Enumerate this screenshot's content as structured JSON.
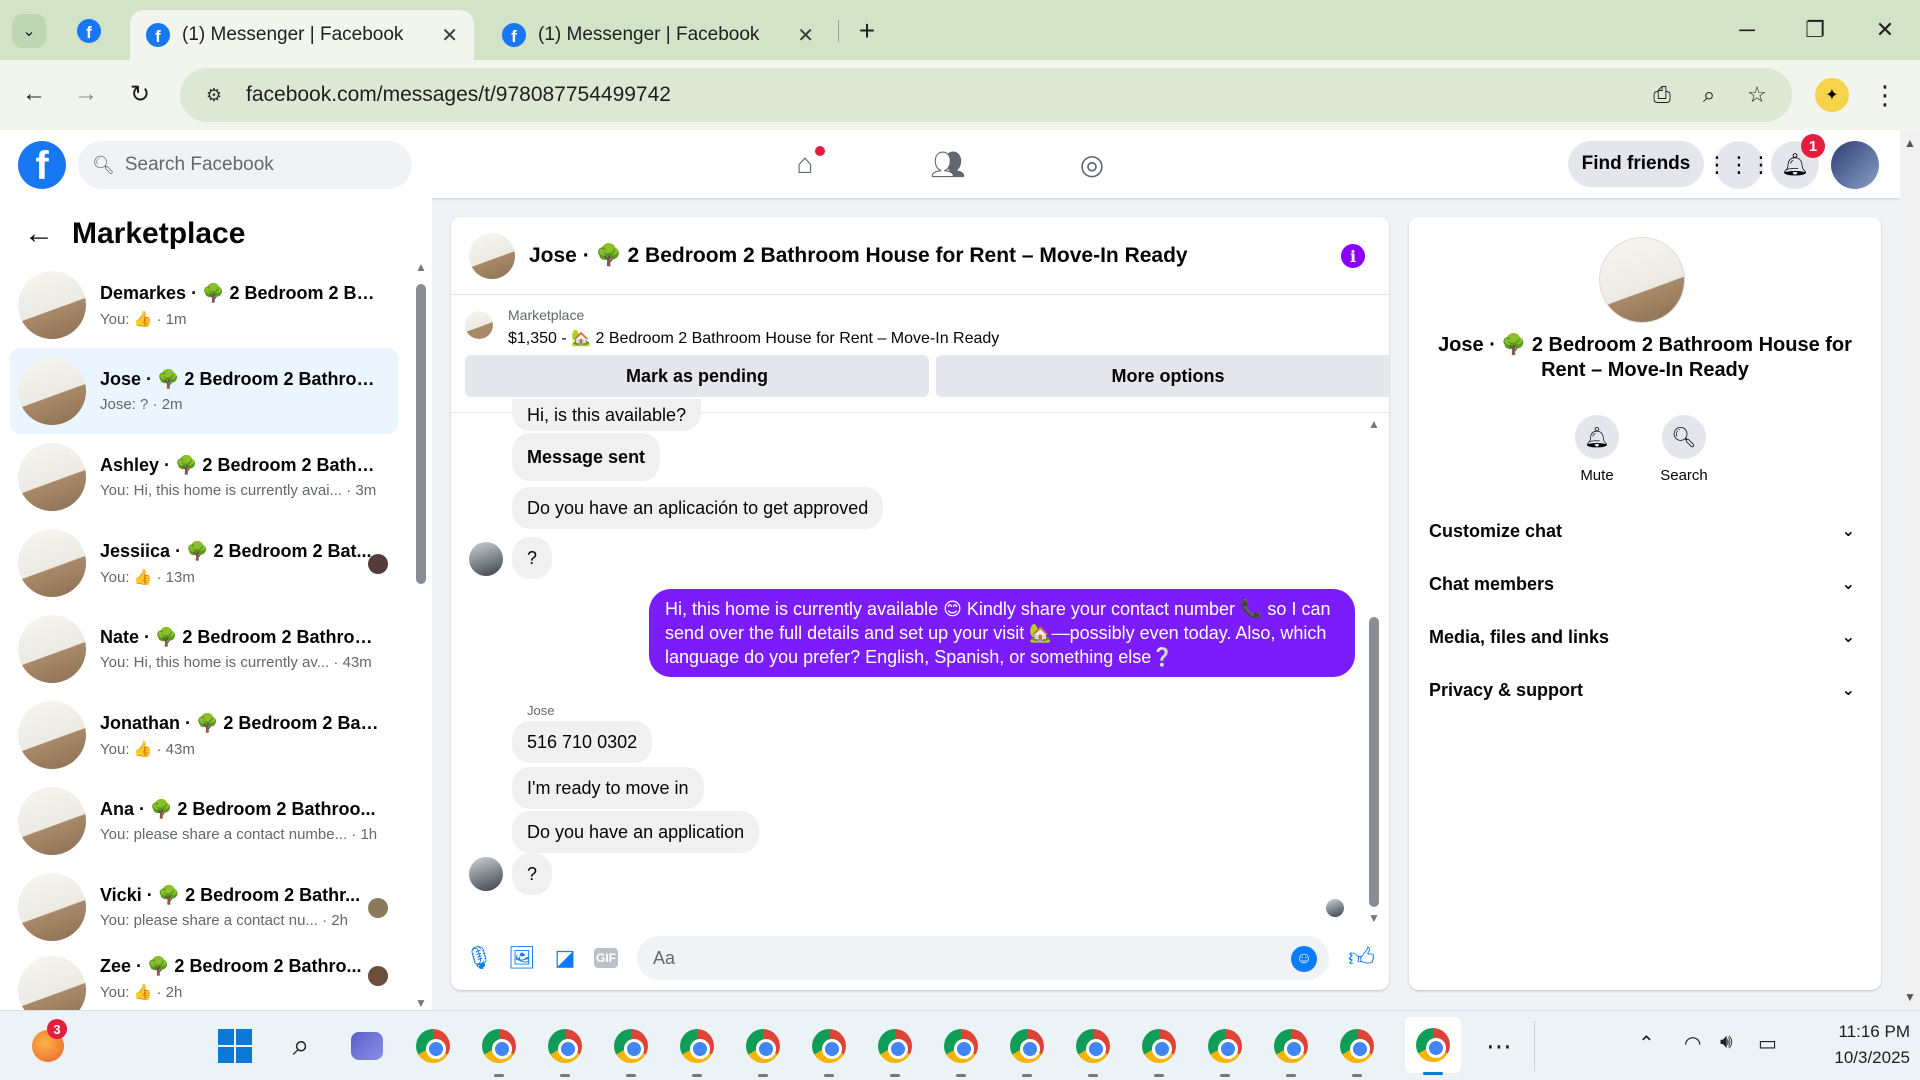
{
  "browser": {
    "tabs": [
      {
        "title": "(1) Messenger | Facebook"
      },
      {
        "title": "(1) Messenger | Facebook"
      }
    ],
    "url": "facebook.com/messages/t/978087754499742"
  },
  "fb": {
    "search_placeholder": "Search Facebook",
    "find_friends": "Find friends",
    "notification_count": "1"
  },
  "left": {
    "title": "Marketplace",
    "conversations": [
      {
        "name": "Demarkes · 🌳 2 Bedroom 2 Bat...",
        "preview": "You: 👍 · 1m"
      },
      {
        "name": "Jose · 🌳 2 Bedroom 2 Bathroo...",
        "preview": "Jose: ? · 2m"
      },
      {
        "name": "Ashley · 🌳 2 Bedroom 2 Bathro...",
        "preview": "You: Hi, this home is currently avai... · 3m"
      },
      {
        "name": "Jessiica · 🌳 2 Bedroom 2 Bat...",
        "preview": "You: 👍 · 13m"
      },
      {
        "name": "Nate · 🌳 2 Bedroom 2 Bathroo...",
        "preview": "You: Hi, this home is currently av... · 43m"
      },
      {
        "name": "Jonathan · 🌳 2 Bedroom 2 Bat...",
        "preview": "You: 👍 · 43m"
      },
      {
        "name": "Ana · 🌳 2 Bedroom 2 Bathroo...",
        "preview": "You: please share a contact numbe... · 1h"
      },
      {
        "name": "Vicki · 🌳 2 Bedroom 2 Bathr...",
        "preview": "You: please share a contact nu... · 2h"
      },
      {
        "name": "Zee · 🌳 2 Bedroom 2 Bathro...",
        "preview": "You: 👍 · 2h"
      }
    ]
  },
  "chat": {
    "title": "Jose · 🌳 2 Bedroom 2 Bathroom House for Rent – Move-In Ready",
    "listing_label": "Marketplace",
    "listing_price": "$1,350 - 🏡 2 Bedroom 2 Bathroom House for Rent – Move-In Ready",
    "mark_pending": "Mark as pending",
    "more_options": "More options",
    "messages": [
      {
        "text": "Hi, is this available?"
      },
      {
        "text": "Message sent"
      },
      {
        "text": "Do you have an aplicación to get approved"
      },
      {
        "text": "?"
      },
      {
        "text": "Hi, this home is currently available 😊 Kindly share your contact number 📞 so I can send over the full details and set up your visit 🏡—possibly even today. Also, which language do you prefer? English, Spanish, or something else❔"
      },
      {
        "text": "Jose"
      },
      {
        "text": "516 710 0302"
      },
      {
        "text": "I'm ready to move in"
      },
      {
        "text": "Do you have an application"
      },
      {
        "text": "?"
      }
    ],
    "composer_placeholder": "Aa",
    "gif_label": "GIF"
  },
  "info": {
    "title": "Jose · 🌳 2 Bedroom 2 Bathroom House for Rent – Move-In Ready",
    "mute": "Mute",
    "search": "Search",
    "sections": [
      {
        "label": "Customize chat"
      },
      {
        "label": "Chat members"
      },
      {
        "label": "Media, files and links"
      },
      {
        "label": "Privacy & support"
      }
    ]
  },
  "taskbar": {
    "badge": "3",
    "time": "11:16 PM",
    "date": "10/3/2025"
  }
}
